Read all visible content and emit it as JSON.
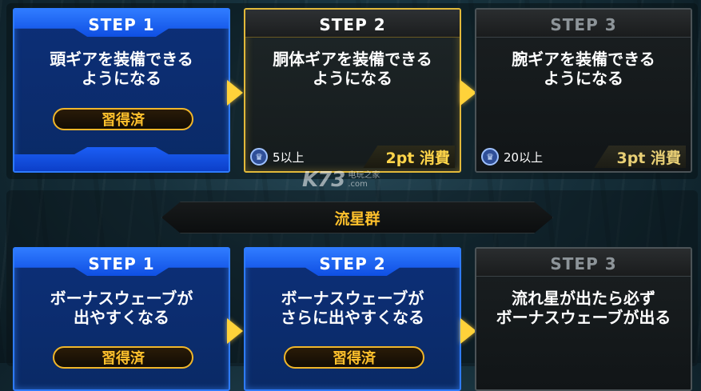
{
  "watermark": {
    "main": "K73",
    "sub": "电玩之家\n.com"
  },
  "panel_top": {
    "steps": [
      {
        "label": "STEP 1",
        "description": "頭ギアを装備できる\nようになる",
        "status_button": "習得済"
      },
      {
        "label": "STEP 2",
        "description": "胴体ギアを装備できる\nようになる",
        "level_requirement": "5以上",
        "cost": "2pt 消費"
      },
      {
        "label": "STEP 3",
        "description": "腕ギアを装備できる\nようになる",
        "level_requirement": "20以上",
        "cost": "3pt 消費"
      }
    ]
  },
  "panel_bottom": {
    "title": "流星群",
    "steps": [
      {
        "label": "STEP 1",
        "description": "ボーナスウェーブが\n出やすくなる",
        "status_button": "習得済"
      },
      {
        "label": "STEP 2",
        "description": "ボーナスウェーブが\nさらに出やすくなる",
        "status_button": "習得済"
      },
      {
        "label": "STEP 3",
        "description": "流れ星が出たら必ず\nボーナスウェーブが出る"
      }
    ]
  },
  "colors": {
    "completed_blue": "#2e7bff",
    "active_gold": "#e2b93a",
    "locked_gray": "#4b5357",
    "learned_text": "#ffc12c",
    "arrow": "#ffd23a"
  },
  "icons": {
    "level_badge": "crown-badge-icon",
    "progression_arrow": "arrow-right-icon"
  }
}
